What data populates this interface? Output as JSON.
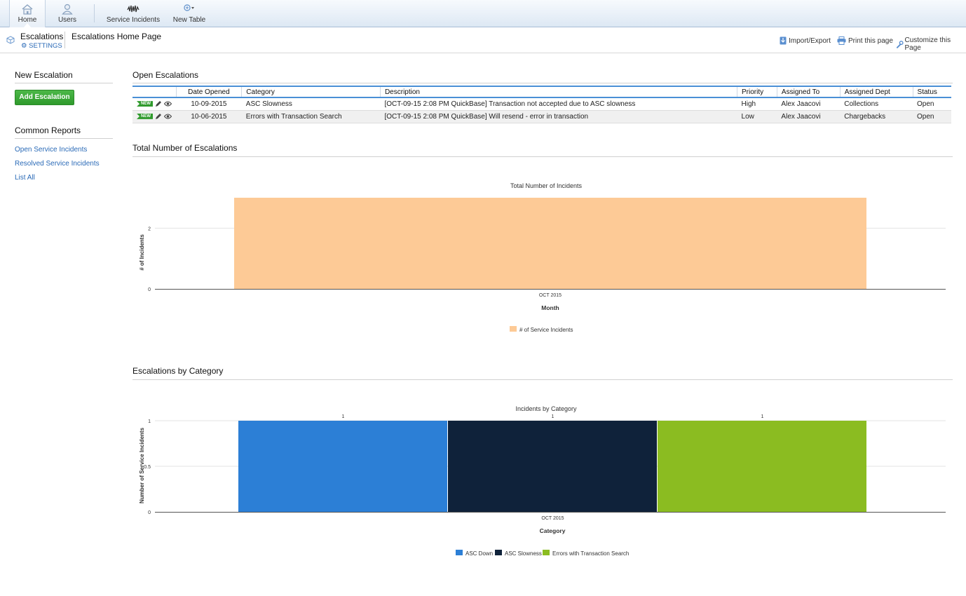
{
  "nav": {
    "tabs": [
      {
        "label": "Home",
        "icon": "home-icon"
      },
      {
        "label": "Users",
        "icon": "user-icon"
      },
      {
        "label": "Service Incidents",
        "icon": "incidents-icon"
      },
      {
        "label": "New Table",
        "icon": "new-table-icon"
      }
    ]
  },
  "header": {
    "app_name": "Escalations",
    "settings_label": "SETTINGS",
    "page_name": "Escalations Home Page",
    "actions": {
      "import_export": "Import/Export",
      "print": "Print this page",
      "customize": "Customize this Page"
    }
  },
  "sidebar": {
    "new_heading": "New Escalation",
    "add_button": "Add Escalation",
    "reports_heading": "Common Reports",
    "links": [
      "Open Service Incidents",
      "Resolved Service Incidents",
      "List All"
    ]
  },
  "open_escalations": {
    "heading": "Open Escalations",
    "badge": "NEW",
    "columns": [
      "Date Opened",
      "Category",
      "Description",
      "Priority",
      "Assigned To",
      "Assigned Dept",
      "Status"
    ],
    "rows": [
      [
        "10-09-2015",
        "ASC Slowness",
        "[OCT-09-15  2:08 PM  QuickBase] Transaction not accepted due to ASC slowness",
        "High",
        "Alex Jaacovi",
        "Collections",
        "Open"
      ],
      [
        "10-06-2015",
        "Errors with Transaction Search",
        "[OCT-09-15  2:08 PM  QuickBase] Will resend - error in transaction",
        "Low",
        "Alex Jaacovi",
        "Chargebacks",
        "Open"
      ]
    ]
  },
  "total_section": {
    "heading": "Total Number of Escalations"
  },
  "category_section": {
    "heading": "Escalations by Category"
  },
  "chart_data": [
    {
      "type": "bar",
      "title": "Total Number of Incidents",
      "xlabel": "Month",
      "ylabel": "# of Incidents",
      "categories": [
        "OCT 2015"
      ],
      "series": [
        {
          "name": "# of Service Incidents",
          "values": [
            3
          ],
          "color": "#fdca96"
        }
      ],
      "yticks": [
        0,
        2
      ],
      "ylim": [
        0,
        3
      ],
      "grid": true,
      "legend": "bottom"
    },
    {
      "type": "bar",
      "title": "Incidents by Category",
      "xlabel": "Category",
      "ylabel": "Number of Service Incidents",
      "categories": [
        "OCT 2015"
      ],
      "series": [
        {
          "name": "ASC Down",
          "values": [
            1
          ],
          "color": "#2c7fd6"
        },
        {
          "name": "ASC Slowness",
          "values": [
            1
          ],
          "color": "#0f223a"
        },
        {
          "name": "Errors with Transaction Search",
          "values": [
            1
          ],
          "color": "#8bbc21"
        }
      ],
      "yticks": [
        0,
        0.5,
        1
      ],
      "ylim": [
        0,
        1
      ],
      "data_labels": true,
      "grid": true,
      "legend": "bottom"
    }
  ]
}
